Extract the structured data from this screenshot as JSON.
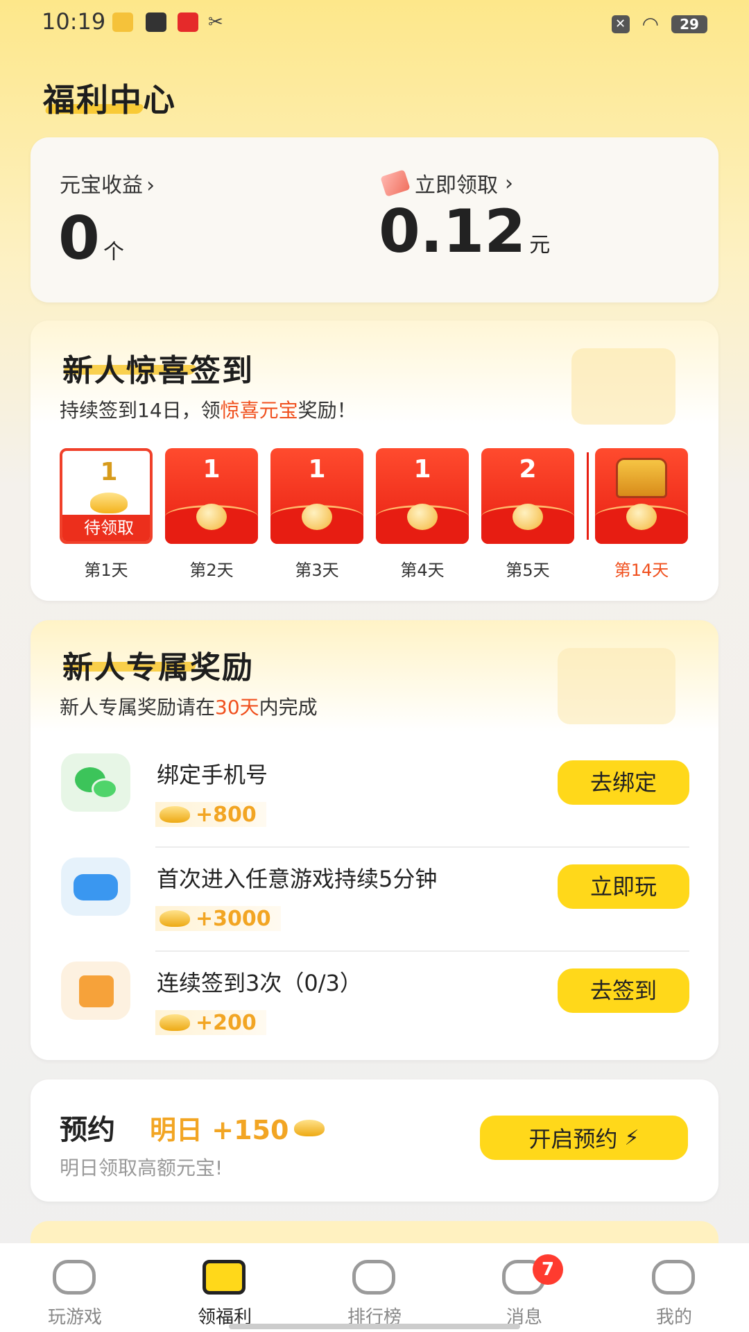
{
  "status_bar": {
    "time": "10:19",
    "battery": "29"
  },
  "page_title": "福利中心",
  "earnings": {
    "ingot_label": "元宝收益",
    "ingot_value": "0",
    "ingot_unit": "个",
    "cash_label": "立即领取",
    "cash_value": "0.12",
    "cash_unit": "元",
    "chevron": "›"
  },
  "signin": {
    "title": "新人惊喜签到",
    "subtitle_pre": "持续签到14日，领",
    "subtitle_hl": "惊喜元宝",
    "subtitle_post": "奖励！",
    "pending_label": "待领取",
    "days": [
      {
        "amount": "1",
        "label": "第1天"
      },
      {
        "amount": "1",
        "label": "第2天"
      },
      {
        "amount": "1",
        "label": "第3天"
      },
      {
        "amount": "1",
        "label": "第4天"
      },
      {
        "amount": "2",
        "label": "第5天"
      },
      {
        "amount": "",
        "label": "第14天"
      }
    ],
    "colors": {
      "accent": "#f0501e",
      "envelope": "#e81f12"
    }
  },
  "rewards": {
    "title": "新人专属奖励",
    "subtitle_pre": "新人专属奖励请在",
    "subtitle_hl": "30天",
    "subtitle_post": "内完成",
    "tasks": [
      {
        "icon": "wechat-icon",
        "title": "绑定手机号",
        "reward": "+800",
        "button": "去绑定"
      },
      {
        "icon": "gamepad-icon",
        "title": "首次进入任意游戏持续5分钟",
        "reward": "+3000",
        "button": "立即玩"
      },
      {
        "icon": "calendar-check-icon",
        "title": "连续签到3次（0/3）",
        "reward": "+200",
        "button": "去签到"
      }
    ]
  },
  "reserve": {
    "title": "预约",
    "bonus": "明日 +150",
    "subtitle": "明日领取高额元宝!",
    "button": "开启预约"
  },
  "nav": {
    "items": [
      {
        "label": "玩游戏",
        "icon": "gamepad-icon"
      },
      {
        "label": "领福利",
        "icon": "gift-icon"
      },
      {
        "label": "排行榜",
        "icon": "ranking-icon"
      },
      {
        "label": "消息",
        "icon": "message-icon"
      },
      {
        "label": "我的",
        "icon": "profile-icon"
      }
    ],
    "active_index": 1,
    "message_badge": "7"
  }
}
